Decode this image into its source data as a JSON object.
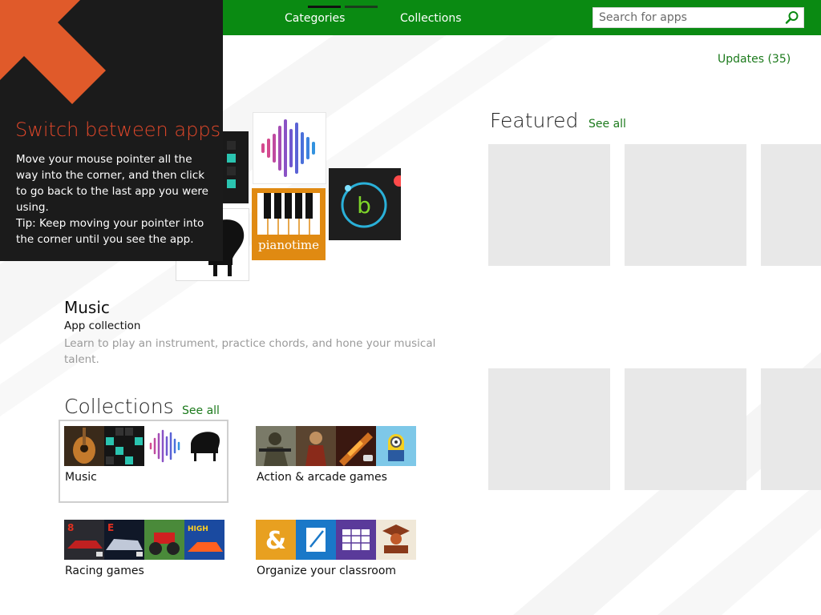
{
  "top_nav": {
    "tabs": [
      {
        "label": "Categories"
      },
      {
        "label": "Collections"
      }
    ],
    "search": {
      "placeholder": "Search for apps",
      "value": ""
    }
  },
  "updates_link": "Updates (35)",
  "tip": {
    "title": "Switch between apps",
    "body_lines": [
      "Move your mouse pointer all the way into the corner, and then click to go back to the last app you were using.",
      "Tip: Keep moving your pointer into the corner until you see the app."
    ]
  },
  "hero": {
    "title": "Music",
    "subtitle": "App collection",
    "description": "Learn to play an instrument, practice chords, and hone your musical talent.",
    "pianotime_label": "pianotime",
    "b_letter": "b"
  },
  "collections": {
    "title": "Collections",
    "see_all": "See all",
    "items": [
      {
        "label": "Music",
        "selected": true,
        "thumbs": [
          "guitar-icon",
          "grid-pads-icon",
          "waveform-icon",
          "grand-piano-icon"
        ]
      },
      {
        "label": "Action & arcade games",
        "selected": false,
        "thumbs": [
          "soldier-game-icon",
          "warrior-game-icon",
          "rifle-game-icon",
          "minion-game-icon"
        ]
      },
      {
        "label": "Racing games",
        "selected": false,
        "thumbs": [
          "racing-car-8-icon",
          "racing-car-e-icon",
          "monster-truck-icon",
          "high-speed-racing-icon"
        ]
      },
      {
        "label": "Organize your classroom",
        "selected": false,
        "thumbs": [
          "ampersand-app-icon",
          "pen-note-app-icon",
          "calendar-app-icon",
          "graduate-app-icon"
        ]
      }
    ]
  },
  "featured": {
    "title": "Featured",
    "see_all": "See all",
    "tile_count": 6
  },
  "colors": {
    "accent_green": "#0a8a12",
    "link_green": "#1c7a1c",
    "tip_title_orange": "#e1472a",
    "tip_background": "#1b1b1b",
    "pianotime_orange": "#e08a12"
  }
}
